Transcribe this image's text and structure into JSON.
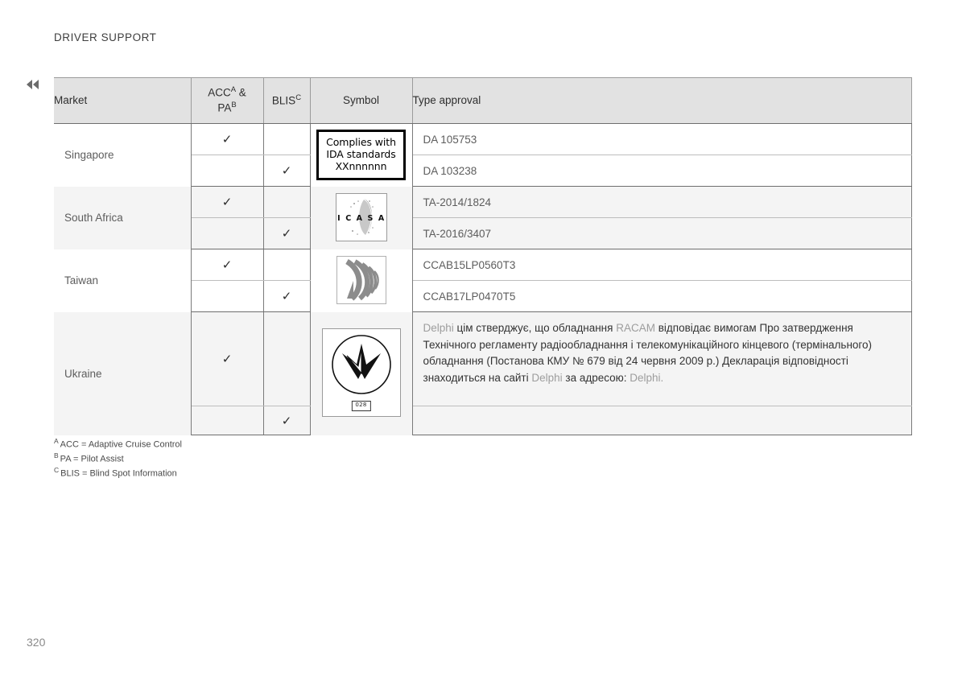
{
  "page": {
    "section_title": "DRIVER SUPPORT",
    "page_number": "320",
    "nav_prev_icon": "double-chevron-left-icon"
  },
  "table": {
    "headers": {
      "market": "Market",
      "acc_pa": "ACC",
      "acc_pa_sup_a": "A",
      "acc_pa_amp": " & ",
      "acc_pa_2": "PA",
      "acc_pa_sup_b": "B",
      "blis": "BLIS",
      "blis_sup": "C",
      "symbol": "Symbol",
      "type_approval": "Type approval"
    },
    "rows": [
      {
        "market": "Singapore",
        "shaded": false,
        "symbol": {
          "kind": "ida-box",
          "line1": "Complies with",
          "line2": "IDA standards",
          "line3": "XXnnnnnn"
        },
        "subrows": [
          {
            "acc_pa": "✓",
            "blis": "",
            "type_approval": "DA 105753"
          },
          {
            "acc_pa": "",
            "blis": "✓",
            "type_approval": "DA 103238"
          }
        ]
      },
      {
        "market": "South Africa",
        "shaded": true,
        "symbol": {
          "kind": "icasa-logo",
          "label": "I C A S A"
        },
        "subrows": [
          {
            "acc_pa": "✓",
            "blis": "",
            "type_approval": "TA-2014/1824"
          },
          {
            "acc_pa": "",
            "blis": "✓",
            "type_approval": "TA-2016/3407"
          }
        ]
      },
      {
        "market": "Taiwan",
        "shaded": false,
        "symbol": {
          "kind": "ncc-logo",
          "label": ""
        },
        "subrows": [
          {
            "acc_pa": "✓",
            "blis": "",
            "type_approval": "CCAB15LP0560T3"
          },
          {
            "acc_pa": "",
            "blis": "✓",
            "type_approval": "CCAB17LP0470T5"
          }
        ]
      },
      {
        "market": "Ukraine",
        "shaded": true,
        "symbol": {
          "kind": "ukrsepro-logo",
          "code": "028"
        },
        "subrows": [
          {
            "acc_pa": "✓",
            "blis": "",
            "type_approval_rich": {
              "p1": "Delphi",
              "p2": " цім стверджує, що обладнання ",
              "p3": "RACAM",
              "p4": " відповідає вимогам Про затвердження Технічного регламенту радіообладнання і телекомунікаційного кінцевого (термінального) обладнання (Постанова КМУ № 679 від 24 червня 2009 р.) Декларація відповідності знаходиться на сайті ",
              "p5": "Delphi",
              "p6": " за адресою: ",
              "p7": "Delphi."
            }
          },
          {
            "acc_pa": "",
            "blis": "✓",
            "type_approval": ""
          }
        ]
      }
    ]
  },
  "footnotes": [
    {
      "mark": "A",
      "text": "ACC = Adaptive Cruise Control"
    },
    {
      "mark": "B",
      "text": "PA = Pilot Assist"
    },
    {
      "mark": "C",
      "text": "BLIS = Blind Spot Information"
    }
  ]
}
